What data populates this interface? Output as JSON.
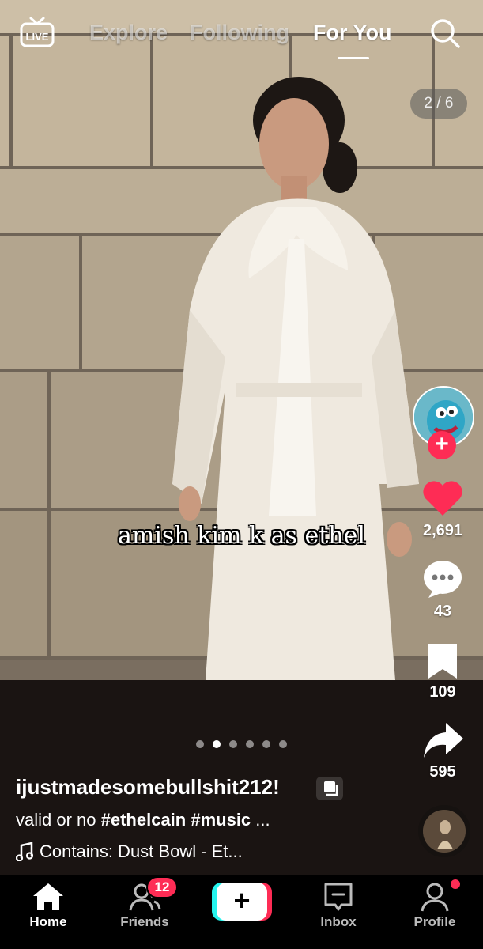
{
  "top_nav": {
    "live_label": "LIVE",
    "tabs": [
      "Explore",
      "Following",
      "For You"
    ],
    "active_tab": "For You"
  },
  "media": {
    "page_counter": "2 / 6",
    "caption_overlay": "amish kim k as ethel",
    "dots_total": 6,
    "dots_active_index": 1
  },
  "actions": {
    "likes": "2,691",
    "comments": "43",
    "saves": "109",
    "shares": "595"
  },
  "post": {
    "username": "ijustmadesomebullshit212!",
    "description_text": "valid or no ",
    "hashtags": "#ethelcain #music",
    "description_more": " ...",
    "music": "Contains: Dust Bowl - Et..."
  },
  "bottom_nav": {
    "home": "Home",
    "friends": "Friends",
    "friends_badge": "12",
    "inbox": "Inbox",
    "profile": "Profile"
  },
  "colors": {
    "accent": "#fe2c55",
    "cyan": "#25f4ee"
  }
}
